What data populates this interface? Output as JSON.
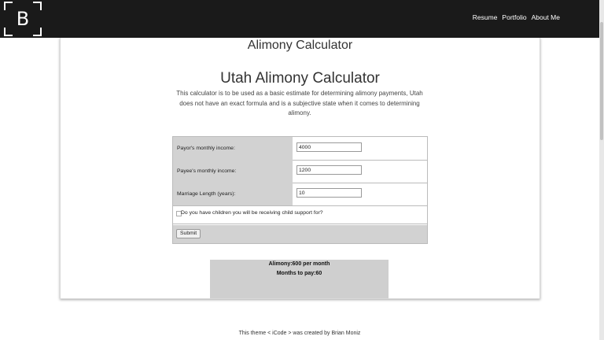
{
  "header": {
    "logo_letter": "B",
    "nav": [
      "Resume",
      "Portfolio",
      "About Me"
    ]
  },
  "card": {
    "title": "Alimony Calculator",
    "heading": "Utah Alimony Calculator",
    "description": "This calculator is to be used as a basic estimate for determining alimony payments, Utah does not have an exact formula and is a subjective state when it comes to determining alimony."
  },
  "form": {
    "payor_label": "Payor's monthly income:",
    "payor_value": "4000",
    "payee_label": "Payee's monthly income:",
    "payee_value": "1200",
    "length_label": "Marriage Length (years):",
    "length_value": "10",
    "children_label": "Do you have children you will be receiving child support for?",
    "children_checked": false,
    "submit_label": "Submit"
  },
  "result": {
    "alimony": "Alimony:600 per month",
    "months": "Months to pay:60"
  },
  "footer": {
    "text": "This theme < iCode > was created by Brian Moniz"
  },
  "colors": {
    "topbar": "#1a1a1a",
    "label_bg": "#d2d2d2",
    "result_bg": "#cfcfcf"
  }
}
